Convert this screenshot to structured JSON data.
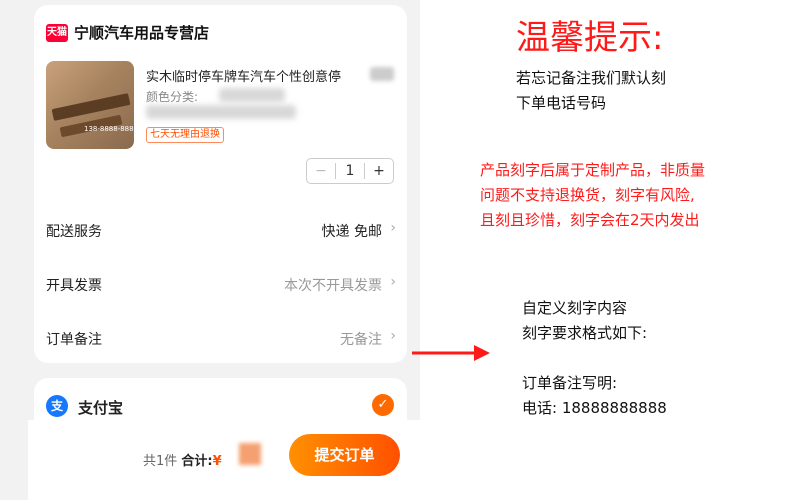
{
  "shop": {
    "badge": "天猫",
    "name": "宁顺汽车用品专营店"
  },
  "product": {
    "title": "实木临时停车牌车汽车个性创意停",
    "variant_label": "颜色分类:",
    "return_tag": "七天无理由退换",
    "thumb_text": "138-8888-8888",
    "quantity": "1",
    "qty_minus": "−",
    "qty_plus": "+"
  },
  "rows": {
    "delivery": {
      "label": "配送服务",
      "value": "快递 免邮"
    },
    "invoice": {
      "label": "开具发票",
      "value": "本次不开具发票"
    },
    "note": {
      "label": "订单备注",
      "value": "无备注"
    }
  },
  "payment": {
    "logo": "支",
    "label": "支付宝",
    "check": "✓"
  },
  "footer": {
    "count": "共1件",
    "total_label": "合计:",
    "currency": "¥",
    "submit": "提交订单"
  },
  "tips": {
    "title": "温馨提示:",
    "line1": "若忘记备注我们默认刻",
    "line2": "下单电话号码",
    "red1": "产品刻字后属于定制产品，非质量",
    "red2": "问题不支持退换货，刻字有风险,",
    "red3": "且刻且珍惜，刻字会在2天内发出",
    "custom1": "自定义刻字内容",
    "custom2": "刻字要求格式如下:",
    "custom3": "订单备注写明:",
    "custom4": "电话: 18888888888"
  },
  "colors": {
    "accent": "#ff5000",
    "tip_red": "#ff1a1a",
    "tmall": "#ff0036",
    "alipay": "#1677ff"
  },
  "icons": {
    "chevron": "chevron-right-icon",
    "arrow": "red-arrow-icon"
  }
}
